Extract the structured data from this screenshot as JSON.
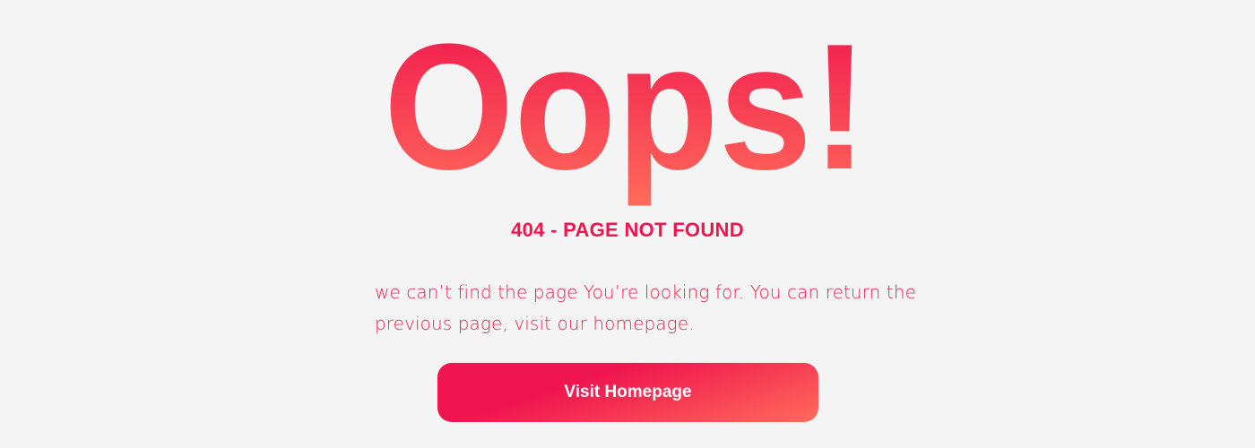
{
  "hero": {
    "title": "Oops!",
    "gradient_top": "#f0154f",
    "gradient_bottom": "#ff6b5a"
  },
  "error": {
    "heading": "404 - PAGE NOT FOUND",
    "message": "we can’t find the page You’re looking for. You can return the previous page, visit our homepage."
  },
  "actions": {
    "home_label": "Visit Homepage"
  },
  "colors": {
    "background": "#f4f4f4",
    "accent": "#f0154f"
  }
}
